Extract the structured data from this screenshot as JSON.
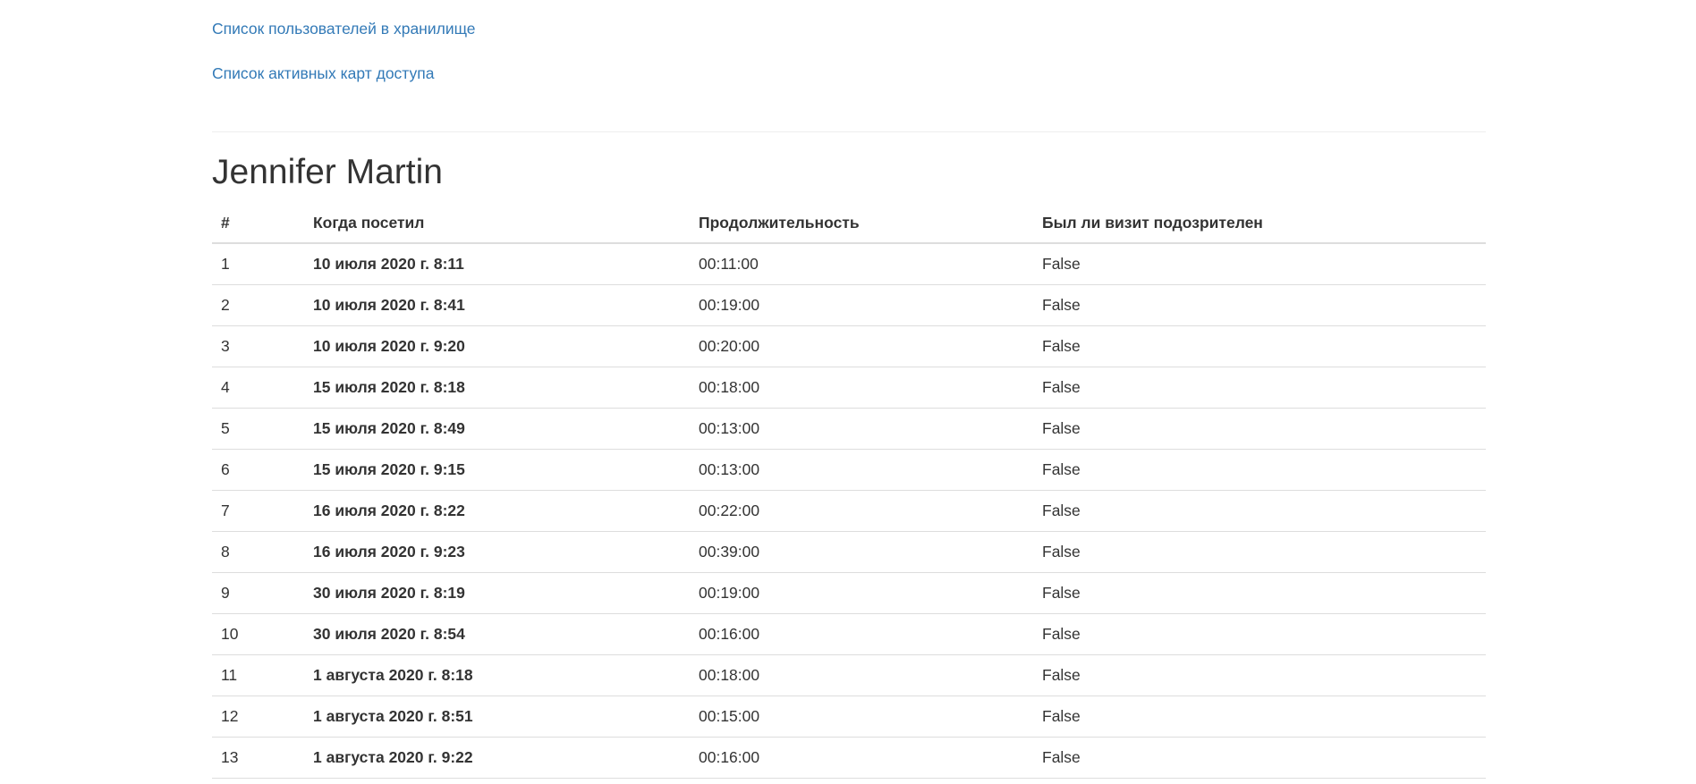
{
  "nav": {
    "links": [
      "Список пользователей в хранилище",
      "Список активных карт доступа"
    ]
  },
  "person": {
    "name": "Jennifer Martin"
  },
  "table": {
    "headers": [
      "#",
      "Когда посетил",
      "Продолжительность",
      "Был ли визит подозрителен"
    ],
    "rows": [
      [
        "1",
        "10 июля 2020 г. 8:11",
        "00:11:00",
        "False"
      ],
      [
        "2",
        "10 июля 2020 г. 8:41",
        "00:19:00",
        "False"
      ],
      [
        "3",
        "10 июля 2020 г. 9:20",
        "00:20:00",
        "False"
      ],
      [
        "4",
        "15 июля 2020 г. 8:18",
        "00:18:00",
        "False"
      ],
      [
        "5",
        "15 июля 2020 г. 8:49",
        "00:13:00",
        "False"
      ],
      [
        "6",
        "15 июля 2020 г. 9:15",
        "00:13:00",
        "False"
      ],
      [
        "7",
        "16 июля 2020 г. 8:22",
        "00:22:00",
        "False"
      ],
      [
        "8",
        "16 июля 2020 г. 9:23",
        "00:39:00",
        "False"
      ],
      [
        "9",
        "30 июля 2020 г. 8:19",
        "00:19:00",
        "False"
      ],
      [
        "10",
        "30 июля 2020 г. 8:54",
        "00:16:00",
        "False"
      ],
      [
        "11",
        "1 августа 2020 г. 8:18",
        "00:18:00",
        "False"
      ],
      [
        "12",
        "1 августа 2020 г. 8:51",
        "00:15:00",
        "False"
      ],
      [
        "13",
        "1 августа 2020 г. 9:22",
        "00:16:00",
        "False"
      ]
    ]
  },
  "colors": {
    "link": "#337ab7",
    "text": "#333333",
    "border": "#dddddd"
  }
}
